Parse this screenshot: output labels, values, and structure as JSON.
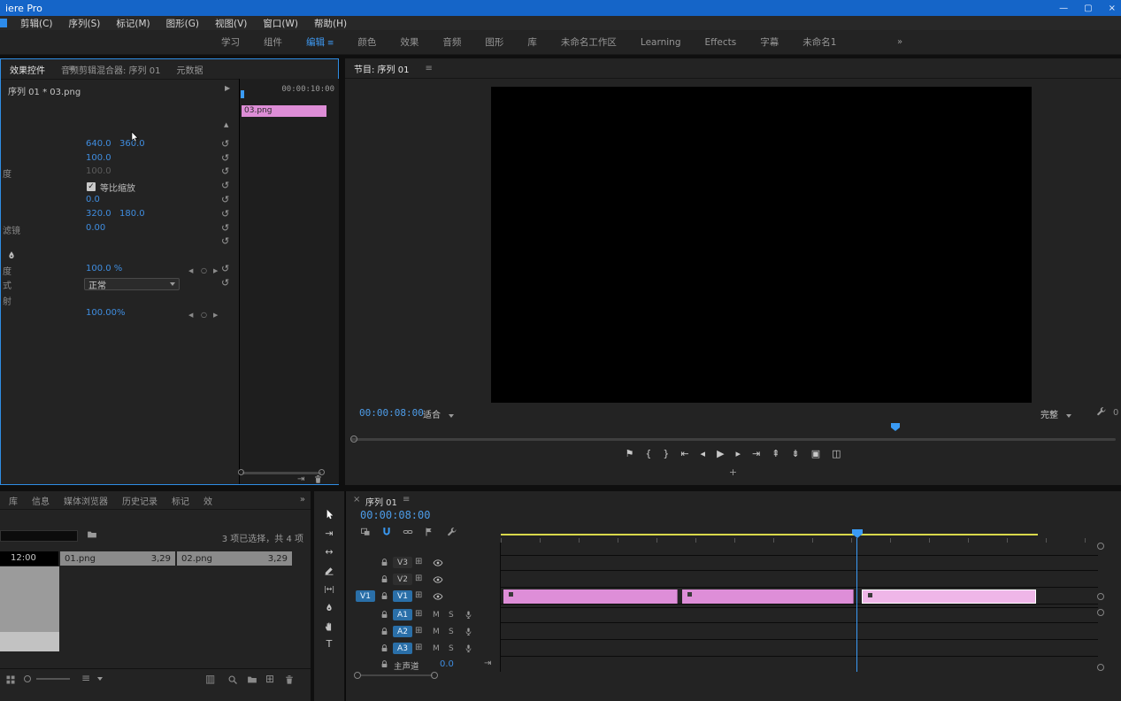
{
  "titlebar": {
    "title": "iere Pro",
    "minimize_glyph": "—",
    "maximize_glyph": "▢",
    "close_glyph": "×"
  },
  "menubar": {
    "items": [
      {
        "name": "menu-clip",
        "label": "剪辑(C)"
      },
      {
        "name": "menu-sequence",
        "label": "序列(S)"
      },
      {
        "name": "menu-markers",
        "label": "标记(M)"
      },
      {
        "name": "menu-graphics",
        "label": "图形(G)"
      },
      {
        "name": "menu-view",
        "label": "视图(V)"
      },
      {
        "name": "menu-window",
        "label": "窗口(W)"
      },
      {
        "name": "menu-help",
        "label": "帮助(H)"
      }
    ]
  },
  "workspaces": {
    "overflow_glyph": "»",
    "tabs": [
      {
        "name": "workspace-tab-learn-cn",
        "label": "学习"
      },
      {
        "name": "workspace-tab-assembly",
        "label": "组件"
      },
      {
        "name": "workspace-tab-editing",
        "label": "编辑",
        "active": true
      },
      {
        "name": "workspace-tab-color",
        "label": "颜色"
      },
      {
        "name": "workspace-tab-effects-cn",
        "label": "效果"
      },
      {
        "name": "workspace-tab-audio",
        "label": "音频"
      },
      {
        "name": "workspace-tab-graphics",
        "label": "图形"
      },
      {
        "name": "workspace-tab-libraries",
        "label": "库"
      },
      {
        "name": "workspace-tab-unnamed",
        "label": "未命名工作区"
      },
      {
        "name": "workspace-tab-learning",
        "label": "Learning"
      },
      {
        "name": "workspace-tab-effects",
        "label": "Effects"
      },
      {
        "name": "workspace-tab-captions",
        "label": "字幕"
      },
      {
        "name": "workspace-tab-unnamed1",
        "label": "未命名1"
      }
    ]
  },
  "effect_controls": {
    "tabs": [
      {
        "name": "tab-effect-controls",
        "label": "效果控件",
        "active": true
      },
      {
        "name": "tab-audio-clip-mixer",
        "label": "音频剪辑混合器: 序列 01"
      },
      {
        "name": "tab-metadata",
        "label": "元数据"
      }
    ],
    "panel_menu_glyph": "≡",
    "clip_title": "序列 01 * 03.png",
    "header_arrow_glyph": "▶",
    "scroll_up_glyph": "▲",
    "reset_glyph": "↺",
    "check_glyph": "✓",
    "ruler_timecode": "00:00:10:00",
    "clip_bar_label": "03.png",
    "nav": {
      "prev_glyph": "◀",
      "add_glyph": "○",
      "next_glyph": "▶"
    },
    "rows": {
      "position": {
        "x": "640.0",
        "y": "360.0"
      },
      "scale": "100.0",
      "scale_width": "100.0",
      "uniform_scale_label": "等比缩放",
      "rotation": "0.0",
      "anchor": {
        "x": "320.0",
        "y": "180.0"
      },
      "antiflicker": "0.00",
      "opacity": "100.0 %",
      "blend_mode": "正常",
      "time_remap_speed": "100.00%"
    },
    "label_fragments": {
      "scale_width": "度",
      "antiflicker": "滤镜",
      "opacity": "度",
      "blend": "式",
      "remap": "射"
    },
    "bottom": {
      "next_glyph": "⇥"
    }
  },
  "program": {
    "title": "节目: 序列 01",
    "panel_menu_glyph": "≡",
    "timecode": "00:00:08:00",
    "fit_dropdown": "适合",
    "quality_dropdown": "完整",
    "duration_partial": "0",
    "button_editor_glyph": "+",
    "transport": [
      {
        "name": "add-marker-button",
        "glyph": "⚑"
      },
      {
        "name": "mark-in-button",
        "glyph": "{"
      },
      {
        "name": "mark-out-button",
        "glyph": "}"
      },
      {
        "name": "go-to-in-button",
        "glyph": "⇤"
      },
      {
        "name": "step-back-button",
        "glyph": "◂"
      },
      {
        "name": "play-button",
        "glyph": "▶"
      },
      {
        "name": "step-forward-button",
        "glyph": "▸"
      },
      {
        "name": "go-to-out-button",
        "glyph": "⇥"
      },
      {
        "name": "lift-button",
        "glyph": "⇞"
      },
      {
        "name": "extract-button",
        "glyph": "⇟"
      },
      {
        "name": "export-frame-button",
        "glyph": "▣"
      },
      {
        "name": "comparison-view-button",
        "glyph": "◫"
      }
    ]
  },
  "project": {
    "tabs": [
      {
        "name": "tab-libraries",
        "label": "库"
      },
      {
        "name": "tab-info",
        "label": "信息"
      },
      {
        "name": "tab-media-browser",
        "label": "媒体浏览器"
      },
      {
        "name": "tab-history",
        "label": "历史记录"
      },
      {
        "name": "tab-markers",
        "label": "标记"
      },
      {
        "name": "tab-effects-partial",
        "label": "效"
      }
    ],
    "overflow_glyph": "»",
    "selection_status": "3 项已选择，共 4 项",
    "time_label": "12:00",
    "items": [
      {
        "name": "01.png",
        "duration": "3,29"
      },
      {
        "name": "02.png",
        "duration": "3,29"
      }
    ],
    "list_view_glyph": "≡",
    "automate_glyph": "▥",
    "new_item_glyph": "⊞"
  },
  "tools": {
    "track_select_glyph": "⇥",
    "ripple_glyph": "↔",
    "slip_glyph": "|↔|",
    "type_glyph": "T"
  },
  "timeline": {
    "close_glyph": "×",
    "tab_label": "序列 01",
    "panel_menu_glyph": "≡",
    "timecode": "00:00:08:00",
    "sync_glyph": "⊞",
    "master_fit_glyph": "⇥",
    "mute_label": "M",
    "solo_label": "S",
    "video_tracks": [
      {
        "label": "V3"
      },
      {
        "label": "V2"
      },
      {
        "badge": "V1",
        "label": "V1",
        "active": true
      }
    ],
    "audio_tracks": [
      {
        "label": "A1"
      },
      {
        "label": "A2"
      },
      {
        "label": "A3"
      }
    ],
    "master_track": {
      "label": "主声道",
      "value": "0.0"
    },
    "clips": [
      {
        "selected": false
      },
      {
        "selected": false
      },
      {
        "selected": true
      }
    ]
  }
}
